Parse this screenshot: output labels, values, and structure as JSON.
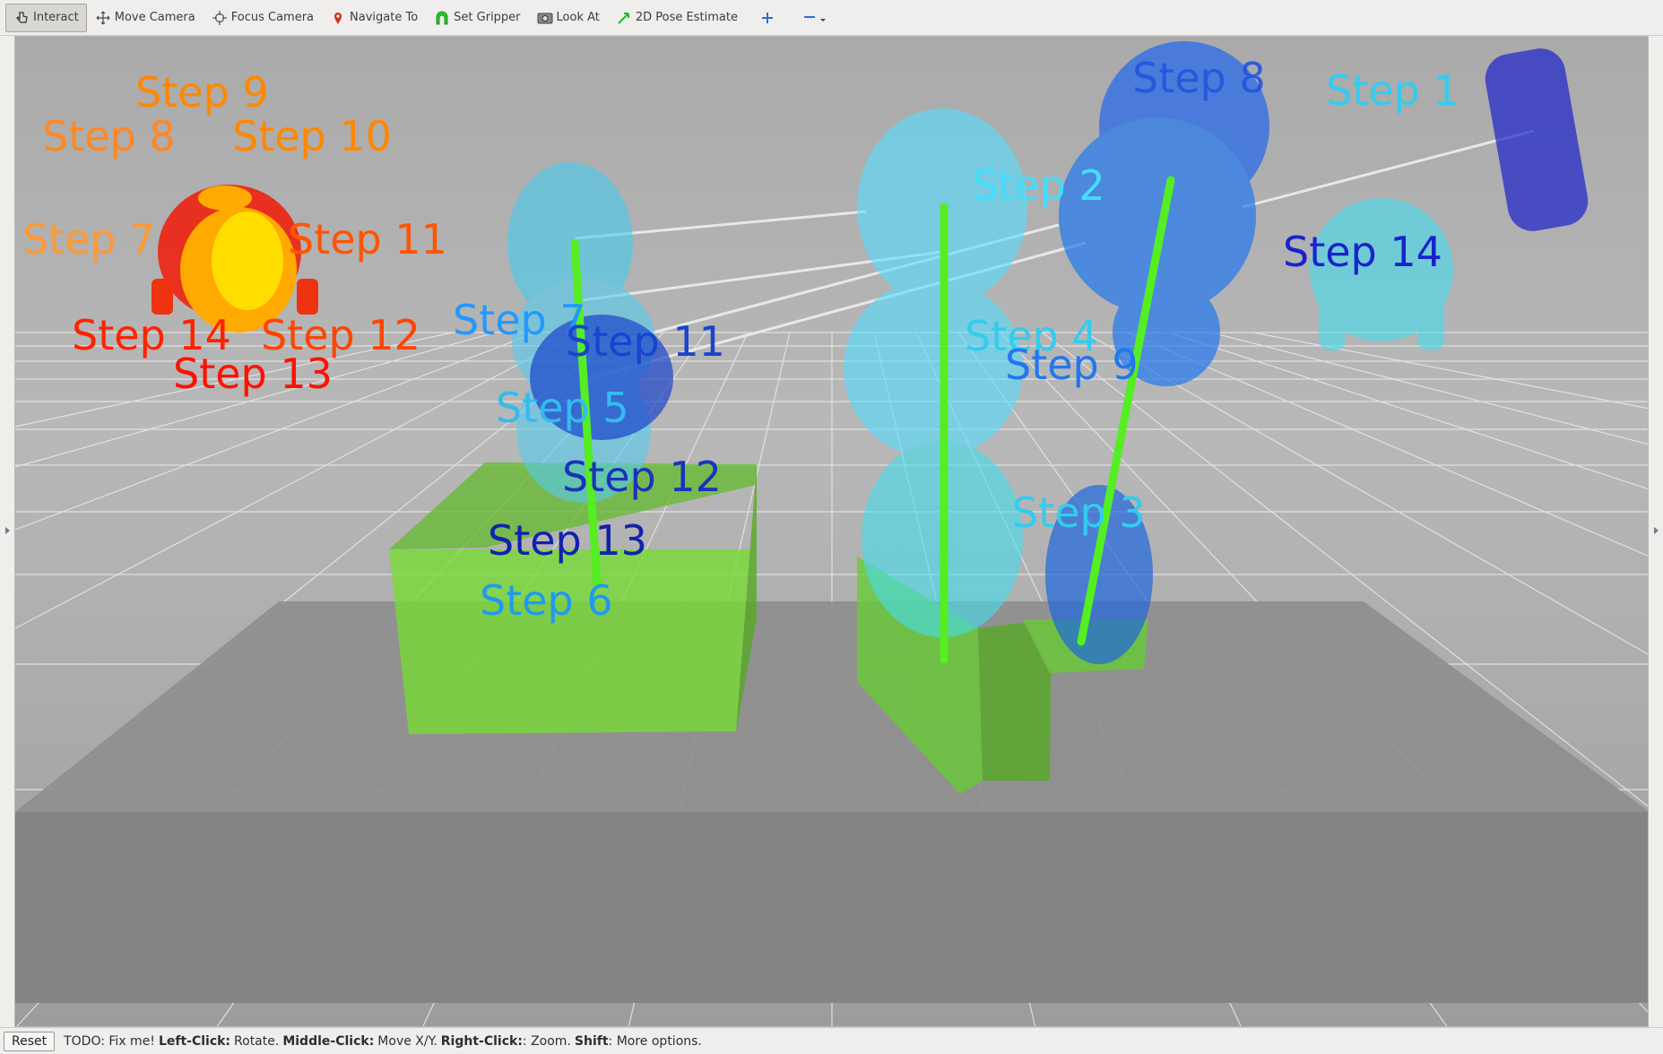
{
  "toolbar": {
    "tools": [
      {
        "label": "Interact",
        "icon": "hand-cursor-icon",
        "active": true
      },
      {
        "label": "Move Camera",
        "icon": "move-camera-icon"
      },
      {
        "label": "Focus Camera",
        "icon": "crosshair-icon"
      },
      {
        "label": "Navigate To",
        "icon": "map-pin-icon"
      },
      {
        "label": "Set Gripper",
        "icon": "gripper-icon"
      },
      {
        "label": "Look At",
        "icon": "camera-icon"
      },
      {
        "label": "2D Pose Estimate",
        "icon": "green-arrow-icon"
      }
    ],
    "add_icon": "plus-icon",
    "remove_icon": "minus-dropdown-icon"
  },
  "viewport": {
    "labels": [
      {
        "text": "Step  8",
        "color": "#2255dd"
      },
      {
        "text": "Step  1",
        "color": "#33ccee"
      },
      {
        "text": "Step  9",
        "color": "#ff8800"
      },
      {
        "text": "Step  8",
        "color": "#ff8822"
      },
      {
        "text": "Step  10",
        "color": "#ff8800"
      },
      {
        "text": "Step  7",
        "color": "#ff9933"
      },
      {
        "text": "Step  11",
        "color": "#ff5500"
      },
      {
        "text": "Step  14",
        "color": "#ff2200"
      },
      {
        "text": "Step  12",
        "color": "#ff4400"
      },
      {
        "text": "Step  13",
        "color": "#ff1100"
      },
      {
        "text": "Step  2",
        "color": "#44ddff"
      },
      {
        "text": "Step  14",
        "color": "#1a22cc"
      },
      {
        "text": "Step  7",
        "color": "#2299ff"
      },
      {
        "text": "Step  11",
        "color": "#1a44cc"
      },
      {
        "text": "Step  4",
        "color": "#33ccee"
      },
      {
        "text": "Step  9",
        "color": "#2277ee"
      },
      {
        "text": "Step  5",
        "color": "#33bbee"
      },
      {
        "text": "Step  12",
        "color": "#1a33bb"
      },
      {
        "text": "Step  3",
        "color": "#33ccee"
      },
      {
        "text": "Step  13",
        "color": "#1122aa"
      },
      {
        "text": "Step  6",
        "color": "#2299ee"
      }
    ]
  },
  "statusbar": {
    "reset_label": "Reset",
    "todo_text": "TODO: Fix me!",
    "left_click_key": "Left-Click:",
    "left_click_action": "Rotate.",
    "middle_click_key": "Middle-Click:",
    "middle_click_action": "Move X/Y.",
    "right_click_key": "Right-Click:",
    "right_click_action": ": Zoom.",
    "shift_key": "Shift",
    "shift_action": ": More options."
  }
}
